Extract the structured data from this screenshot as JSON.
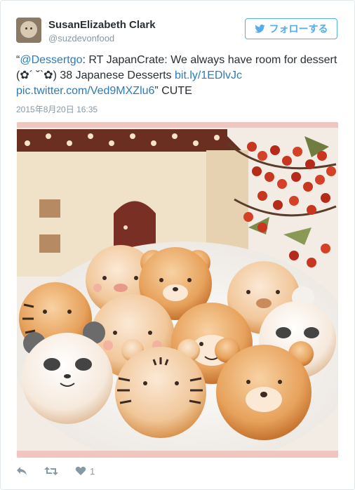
{
  "user": {
    "name": "SusanElizabeth Clark",
    "handle": "@suzdevonfood"
  },
  "follow_button": {
    "label": "フォローする",
    "icon": "twitter-bird-icon"
  },
  "tweet": {
    "open_quote": "“",
    "mention": "@Dessertgo",
    "text_1": ": RT JapanCrate: We always have room for dessert (✿´ ˘`✿) 38 Japanese Desserts ",
    "link_1": "bit.ly/1EDlvJc",
    "link_2": "pic.twitter.com/Ved9MXZlu6",
    "text_2": "” CUTE"
  },
  "timestamp": "2015年8月20日 16:35",
  "actions": {
    "reply_icon": "reply-icon",
    "retweet_icon": "retweet-icon",
    "like_icon": "heart-icon",
    "like_count": "1"
  },
  "colors": {
    "accent": "#55acee",
    "link": "#2b7bb9",
    "text": "#292f33",
    "muted": "#8899a6"
  }
}
